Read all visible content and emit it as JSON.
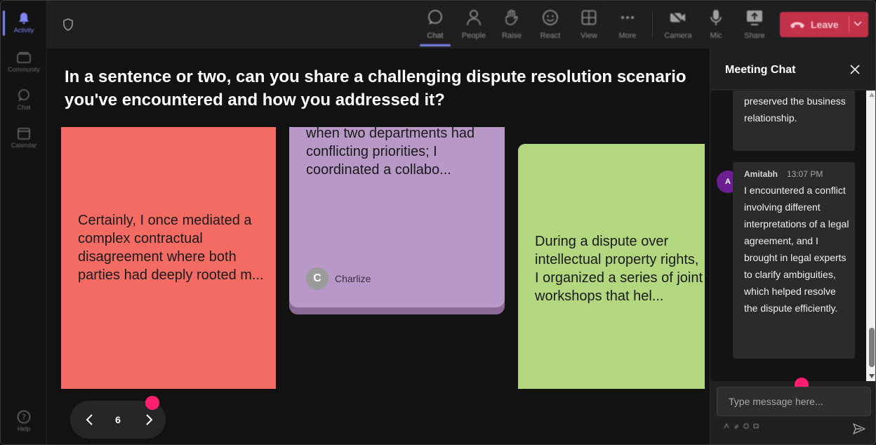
{
  "rail": {
    "items": [
      {
        "label": "Activity",
        "icon": "bell-icon",
        "active": true
      },
      {
        "label": "Community",
        "icon": "community-icon"
      },
      {
        "label": "Chat",
        "icon": "chat-icon"
      },
      {
        "label": "Calendar",
        "icon": "calendar-icon"
      },
      {
        "label": "Help",
        "icon": "help-icon"
      }
    ]
  },
  "toolbar": {
    "chat": "Chat",
    "people": "People",
    "raise": "Raise",
    "react": "React",
    "view": "View",
    "more": "More",
    "camera": "Camera",
    "mic": "Mic",
    "share": "Share",
    "leave": "Leave"
  },
  "stage": {
    "question": "In a sentence or two, can you share a challenging dispute resolution scenario you've encountered and how you addressed it?",
    "cards": [
      {
        "color": "#f36b63",
        "text": "Certainly, I once mediated a complex contractual disagreement where both parties had deeply rooted m..."
      },
      {
        "color": "#b798c7",
        "text": "when two departments had conflicting priorities; I coordinated a collabo...",
        "author": "Charlize",
        "author_initial": "C"
      },
      {
        "color": "#b3d77e",
        "text": "During a dispute over intellectual property rights, I organized a series of joint workshops that hel..."
      }
    ],
    "pager": {
      "page": "6"
    }
  },
  "chat": {
    "title": "Meeting Chat",
    "messages": [
      {
        "text": "preserved the business relationship."
      },
      {
        "author": "Amitabh",
        "initial": "A",
        "time": "13:07 PM",
        "text": "I encountered a conflict involving different interpretations of a legal agreement, and I brought in legal experts to clarify ambiguities, which helped resolve the dispute efficiently."
      }
    ],
    "input_placeholder": "Type message here..."
  },
  "colors": {
    "accent": "#7f85f5",
    "leave": "#c4314b",
    "marker": "#ff1f6e",
    "avatar": "#6b1f93"
  }
}
